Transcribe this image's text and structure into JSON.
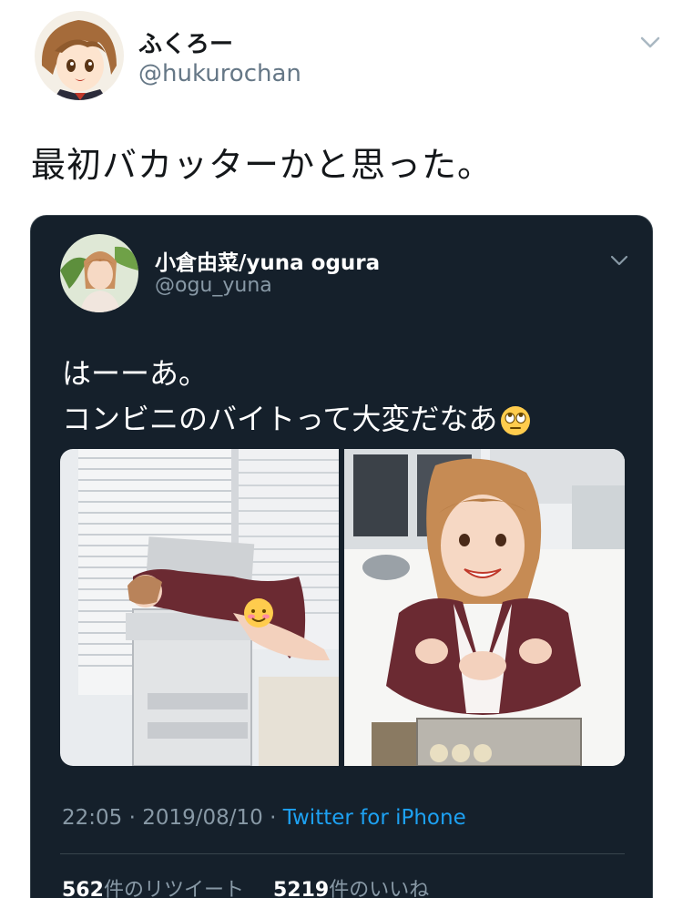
{
  "outer_tweet": {
    "display_name": "ふくろー",
    "handle": "@hukurochan",
    "text": "最初バカッターかと思った。"
  },
  "quoted_tweet": {
    "display_name": "小倉由菜/yuna ogura",
    "handle": "@ogu_yuna",
    "text_line1": "はーーあ。",
    "text_line2": "コンビニのバイトって大変だなあ",
    "emoji": "rolling-eyes-emoji",
    "time": "22:05",
    "date": "2019/08/10",
    "separator": "·",
    "source": "Twitter for iPhone",
    "retweet_count": "562",
    "retweet_label": "件のリツイート",
    "like_count": "5219",
    "like_label": "件のいいね"
  },
  "colors": {
    "card_bg": "#15202b",
    "link_blue": "#1da1f2",
    "muted": "#8899a6"
  }
}
